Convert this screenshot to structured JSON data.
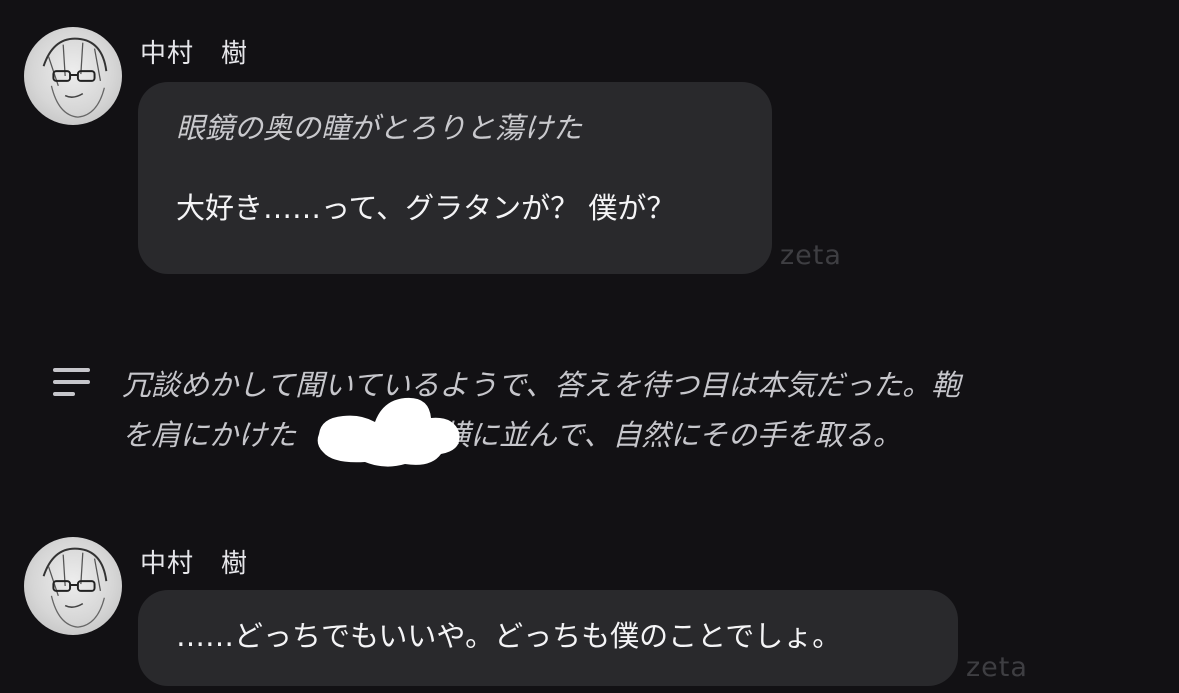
{
  "messages": [
    {
      "sender": "中村　樹",
      "lines": [
        "眼鏡の奥の瞳がとろりと蕩けた",
        "大好き……って、グラタンが？ 僕が？"
      ],
      "watermark": "zeta"
    },
    {
      "sender": "中村　樹",
      "lines": [
        "……どっちでもいいや。どっちも僕のことでしょ。"
      ],
      "watermark": "zeta"
    }
  ],
  "narration": {
    "icon": "text-lines-icon",
    "lines": [
      "冗談めかして聞いているようで、答えを待つ目は本気だった。鞄",
      "を肩にかけた　　　　の横に並んで、自然にその手を取る。"
    ]
  },
  "colors": {
    "background": "#121114",
    "bubble": "#29292c",
    "narration_text": "#c6c6cb",
    "watermark": "#3e3e42"
  }
}
